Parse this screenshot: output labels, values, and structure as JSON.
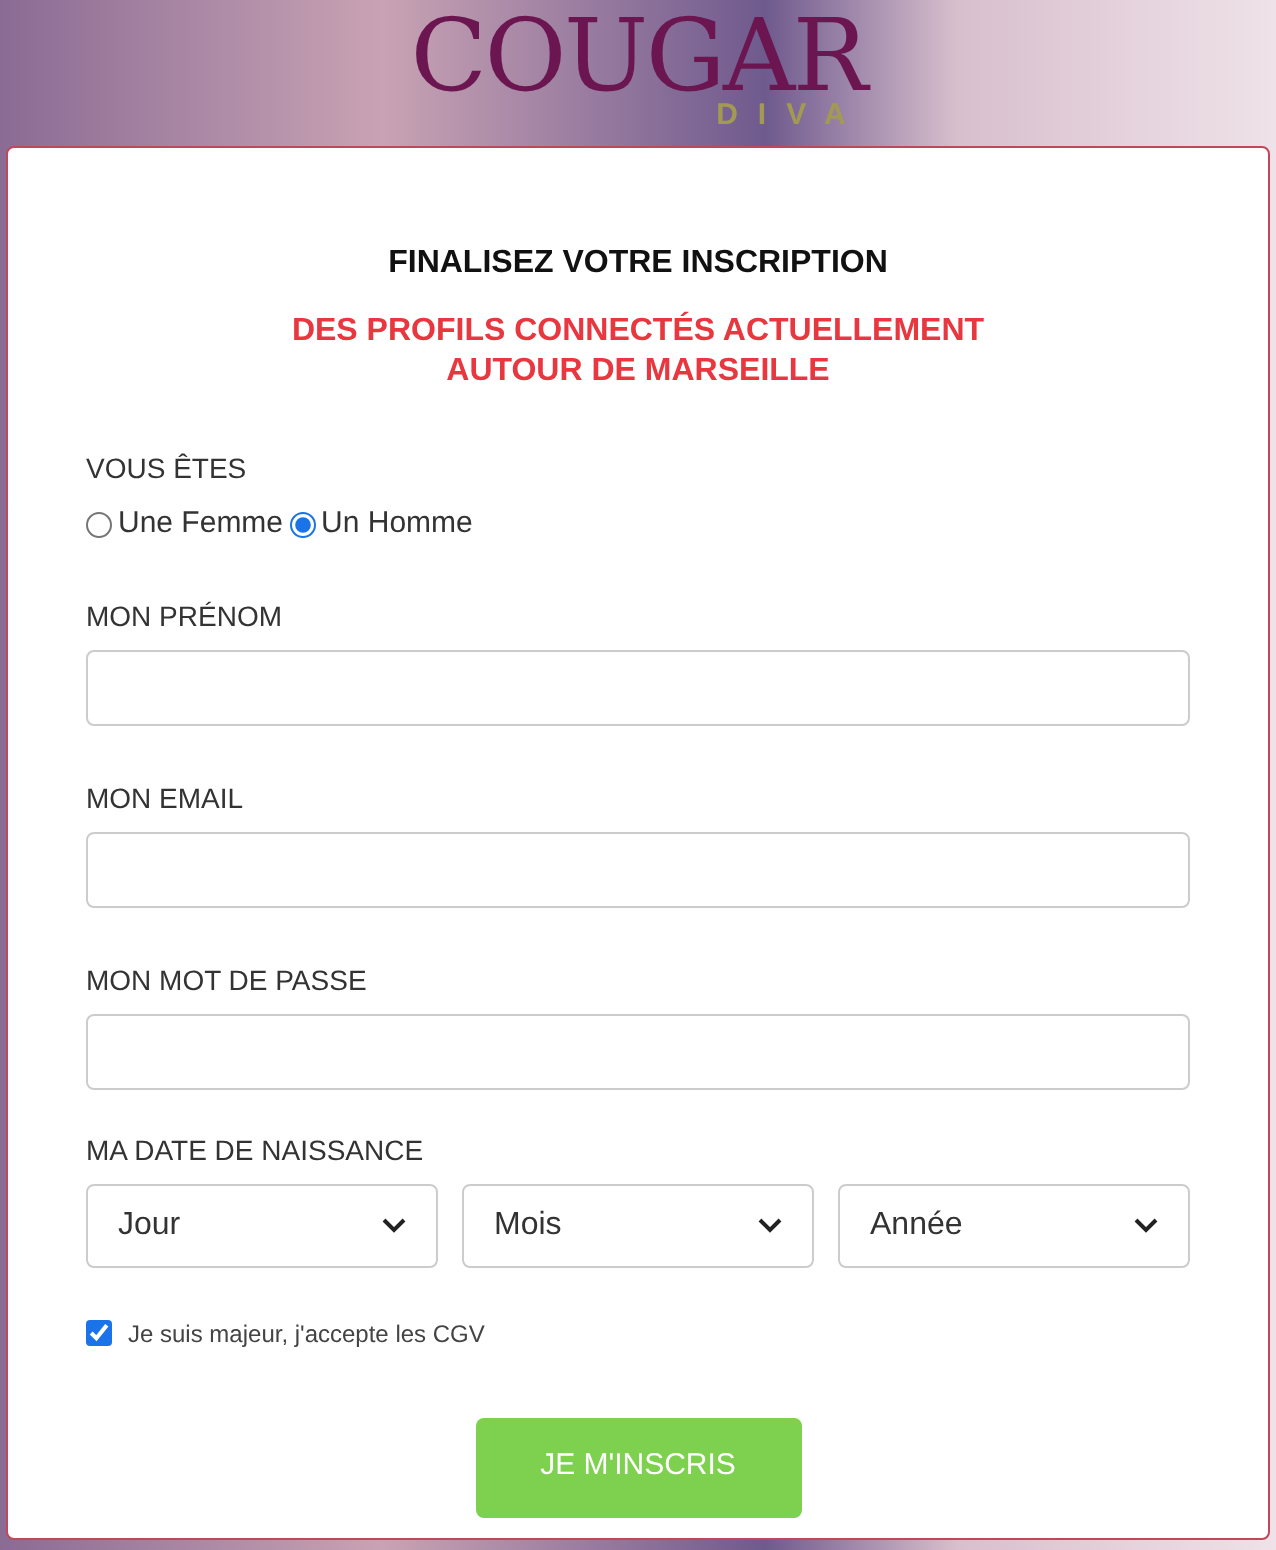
{
  "logo": {
    "name": "COUGAR",
    "tagline": "DIVA"
  },
  "form": {
    "title": "FINALISEZ VOTRE INSCRIPTION",
    "subtitle": [
      "DES PROFILS CONNECTÉS ACTUELLEMENT",
      "AUTOUR DE MARSEILLE"
    ],
    "gender": {
      "label": "VOUS ÊTES",
      "options": [
        {
          "label": "Une Femme",
          "selected": false
        },
        {
          "label": "Un Homme",
          "selected": true
        }
      ]
    },
    "fields": [
      {
        "label": "MON PRÉNOM"
      },
      {
        "label": "MON EMAIL"
      },
      {
        "label": "MON MOT DE PASSE"
      }
    ],
    "birthdate": {
      "label": "MA DATE DE NAISSANCE",
      "selects": [
        {
          "value": "Jour"
        },
        {
          "value": "Mois"
        },
        {
          "value": "Année"
        }
      ]
    },
    "terms": {
      "label": "Je suis majeur, j'accepte les CGV",
      "checked": true
    },
    "submit": "JE M'INSCRIS"
  }
}
